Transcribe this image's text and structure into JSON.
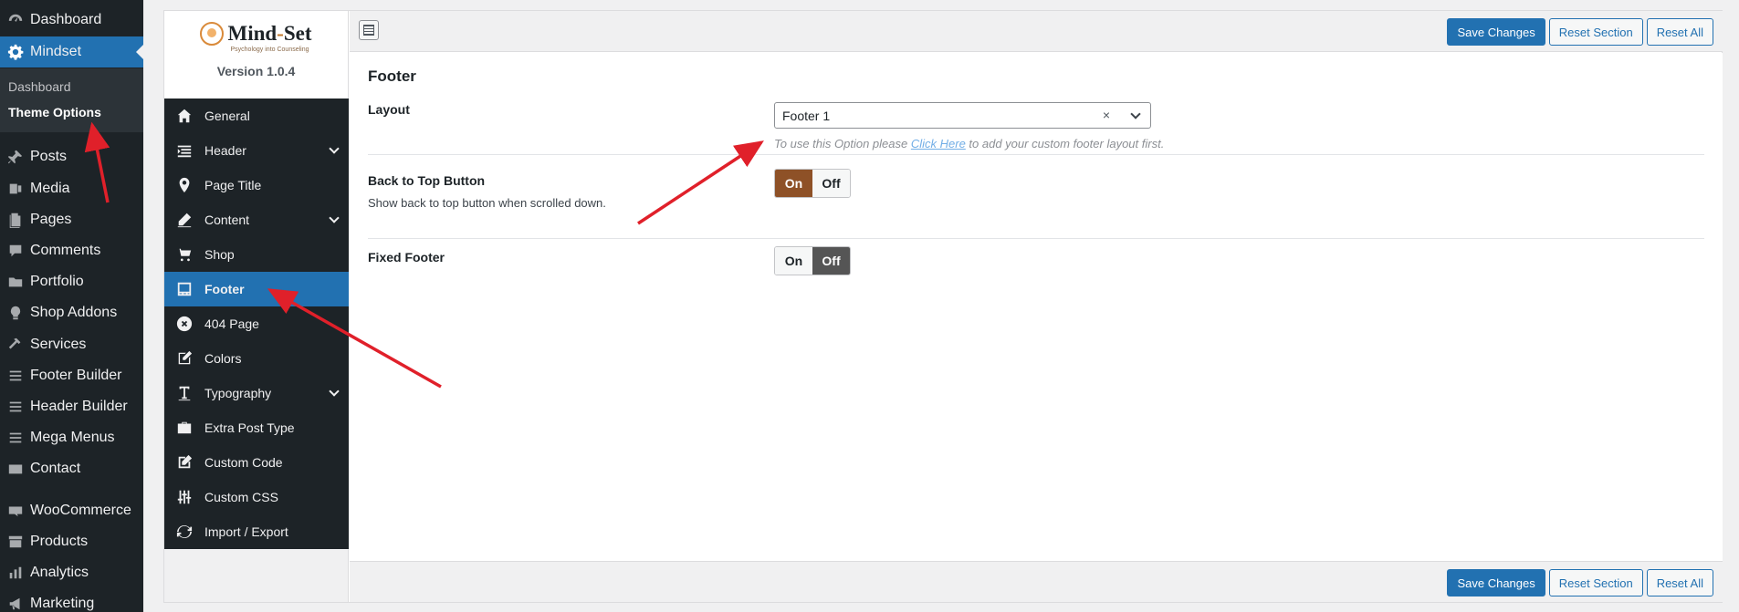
{
  "wp_menu": {
    "items": [
      {
        "label": "Dashboard",
        "icon": "dashboard-icon"
      },
      {
        "label": "Mindset",
        "icon": "gear-icon",
        "active": true
      },
      {
        "label": "Posts",
        "icon": "pin-icon"
      },
      {
        "label": "Media",
        "icon": "media-icon"
      },
      {
        "label": "Pages",
        "icon": "pages-icon"
      },
      {
        "label": "Comments",
        "icon": "comment-icon"
      },
      {
        "label": "Portfolio",
        "icon": "folder-icon"
      },
      {
        "label": "Shop Addons",
        "icon": "lightbulb-icon"
      },
      {
        "label": "Services",
        "icon": "hammer-icon"
      },
      {
        "label": "Footer Builder",
        "icon": "list-icon"
      },
      {
        "label": "Header Builder",
        "icon": "list-icon"
      },
      {
        "label": "Mega Menus",
        "icon": "list-icon"
      },
      {
        "label": "Contact",
        "icon": "mail-icon"
      },
      {
        "label": "WooCommerce",
        "icon": "woo-icon"
      },
      {
        "label": "Products",
        "icon": "archive-icon"
      },
      {
        "label": "Analytics",
        "icon": "bar-chart-icon"
      },
      {
        "label": "Marketing",
        "icon": "megaphone-icon"
      }
    ],
    "submenu": [
      "Dashboard",
      "Theme Options"
    ]
  },
  "brand": {
    "logo_text_a": "Mind",
    "logo_text_dash": "-",
    "logo_text_b": "Set",
    "tagline": "Psychology into Counseling",
    "version": "Version 1.0.4"
  },
  "options_nav": [
    {
      "label": "General",
      "icon": "home-icon"
    },
    {
      "label": "Header",
      "icon": "header-icon",
      "expandable": true
    },
    {
      "label": "Page Title",
      "icon": "location-pin-icon"
    },
    {
      "label": "Content",
      "icon": "pencil-icon",
      "expandable": true
    },
    {
      "label": "Shop",
      "icon": "cart-icon"
    },
    {
      "label": "Footer",
      "icon": "footer-icon",
      "active": true
    },
    {
      "label": "404 Page",
      "icon": "error-icon"
    },
    {
      "label": "Colors",
      "icon": "palette-icon"
    },
    {
      "label": "Typography",
      "icon": "text-icon",
      "expandable": true
    },
    {
      "label": "Extra Post Type",
      "icon": "briefcase-icon"
    },
    {
      "label": "Custom Code",
      "icon": "edit-icon"
    },
    {
      "label": "Custom CSS",
      "icon": "sliders-icon"
    },
    {
      "label": "Import / Export",
      "icon": "refresh-icon"
    }
  ],
  "toolbar": {
    "save_label": "Save Changes",
    "reset_section_label": "Reset Section",
    "reset_all_label": "Reset All"
  },
  "section": {
    "title": "Footer",
    "layout": {
      "label": "Layout",
      "value": "Footer 1",
      "clear": "×",
      "hint_before": "To use this Option please ",
      "hint_link": "Click Here",
      "hint_after": " to add your custom footer layout first."
    },
    "back_to_top": {
      "label": "Back to Top Button",
      "desc": "Show back to top button when scrolled down.",
      "on": "On",
      "off": "Off",
      "state": "on"
    },
    "fixed_footer": {
      "label": "Fixed Footer",
      "on": "On",
      "off": "Off",
      "state": "off"
    }
  },
  "colors": {
    "wp_sidebar": "#1d2327",
    "accent": "#2271b1",
    "switch_on": "#8e5127",
    "switch_off": "#555555",
    "annotation_arrow": "#e0202a"
  }
}
